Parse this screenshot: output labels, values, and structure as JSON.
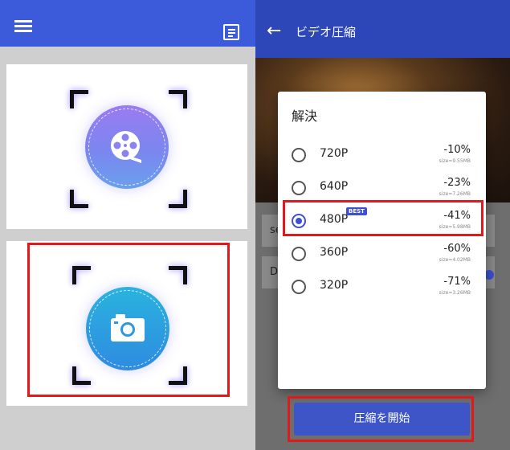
{
  "right_header": {
    "title": "ビデオ圧縮"
  },
  "background_rows": [
    {
      "label": "se"
    },
    {
      "label": "De"
    }
  ],
  "dialog": {
    "title": "解決",
    "options": [
      {
        "resolution": "720P",
        "percent": "-10%",
        "size": "size≈9.55MB",
        "selected": false
      },
      {
        "resolution": "640P",
        "percent": "-23%",
        "size": "size≈7.26MB",
        "selected": false
      },
      {
        "resolution": "480P",
        "percent": "-41%",
        "size": "size≈5.98MB",
        "selected": true,
        "badge": "BEST"
      },
      {
        "resolution": "360P",
        "percent": "-60%",
        "size": "size≈4.02MB",
        "selected": false
      },
      {
        "resolution": "320P",
        "percent": "-71%",
        "size": "size≈3.26MB",
        "selected": false
      }
    ]
  },
  "start_button": {
    "label": "圧縮を開始"
  },
  "icons": {
    "menu": "hamburger-menu-icon",
    "notes": "notes-icon",
    "video": "video-reel-icon",
    "camera": "camera-icon",
    "back": "back-arrow-icon"
  },
  "colors": {
    "header_blue": "#3b5bdb",
    "dialog_accent": "#3d4fd6",
    "highlight_red": "#e0191c"
  }
}
